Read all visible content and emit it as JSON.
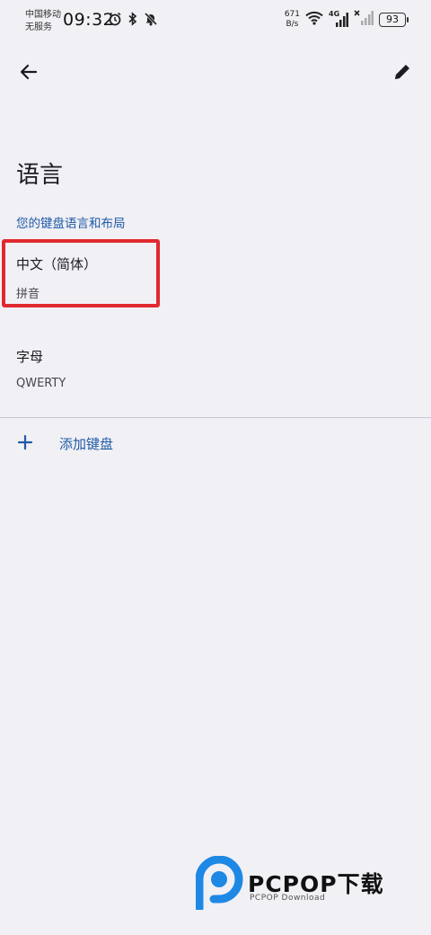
{
  "status_bar": {
    "carrier_line1": "中国移动",
    "carrier_line2": "无服务",
    "time": "09:32",
    "net_speed_value": "671",
    "net_speed_unit": "B/s",
    "network_type": "4G",
    "battery": "93",
    "icons": [
      "alarm-icon",
      "bluetooth-icon",
      "mute-icon",
      "wifi-icon",
      "signal-icon",
      "signal-off-icon",
      "battery-icon"
    ]
  },
  "toolbar": {
    "back_icon": "arrow-left-icon",
    "edit_icon": "pencil-icon"
  },
  "page": {
    "title": "语言",
    "section_header": "您的键盘语言和布局"
  },
  "keyboards": [
    {
      "name": "中文（简体）",
      "layout": "拼音",
      "highlighted": true
    },
    {
      "name": "字母",
      "layout": "QWERTY",
      "highlighted": false
    }
  ],
  "add_keyboard": {
    "label": "添加键盘",
    "icon": "plus-icon"
  },
  "watermark": {
    "title": "PCPOP下载",
    "subtitle": "PCPOP Download"
  },
  "colors": {
    "background": "#f1f0f5",
    "accent": "#1f5aa6",
    "highlight_border": "#e0292f",
    "logo_blue": "#1e88e5"
  }
}
